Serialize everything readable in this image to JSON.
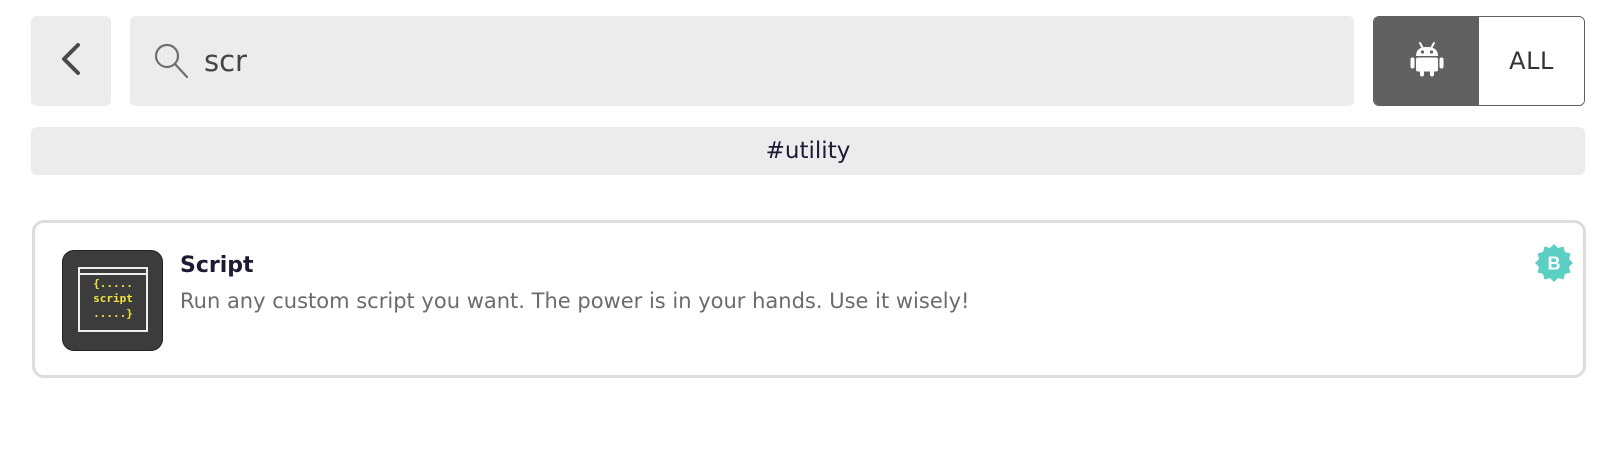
{
  "header": {
    "back_icon": "chevron-left-icon",
    "search": {
      "icon": "search-icon",
      "value": "scr",
      "placeholder": ""
    },
    "platform_toggle": {
      "android_icon": "android-icon",
      "all_label": "ALL",
      "selected": "android"
    }
  },
  "tag_filter": {
    "label": "#utility"
  },
  "results": [
    {
      "title": "Script",
      "description": "Run any custom script you want. The power is in your hands. Use it wisely!",
      "icon": {
        "name": "script-app-icon",
        "lines": [
          "{.....",
          "script",
          ".....}"
        ]
      },
      "badge": {
        "label": "B",
        "color": "#5ccfc4"
      }
    }
  ],
  "colors": {
    "panel_bg": "#ececec",
    "toggle_active": "#616161",
    "title_text": "#1f1a33",
    "badge": "#5ccfc4"
  }
}
